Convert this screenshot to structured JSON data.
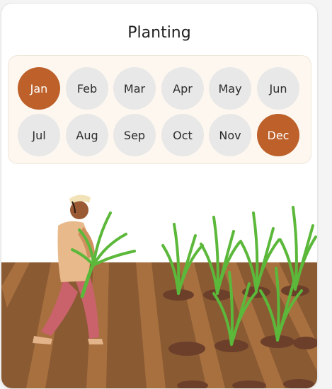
{
  "title": "Planting",
  "months": [
    {
      "label": "Jan",
      "active": true
    },
    {
      "label": "Feb",
      "active": false
    },
    {
      "label": "Mar",
      "active": false
    },
    {
      "label": "Apr",
      "active": false
    },
    {
      "label": "May",
      "active": false
    },
    {
      "label": "Jun",
      "active": false
    },
    {
      "label": "Jul",
      "active": false
    },
    {
      "label": "Aug",
      "active": false
    },
    {
      "label": "Sep",
      "active": false
    },
    {
      "label": "Oct",
      "active": false
    },
    {
      "label": "Nov",
      "active": false
    },
    {
      "label": "Dec",
      "active": true
    }
  ],
  "colors": {
    "active_month": "#bd602a",
    "inactive_month": "#e8e8e8",
    "soil": "#8a5a33",
    "plant": "#5cb83a"
  }
}
